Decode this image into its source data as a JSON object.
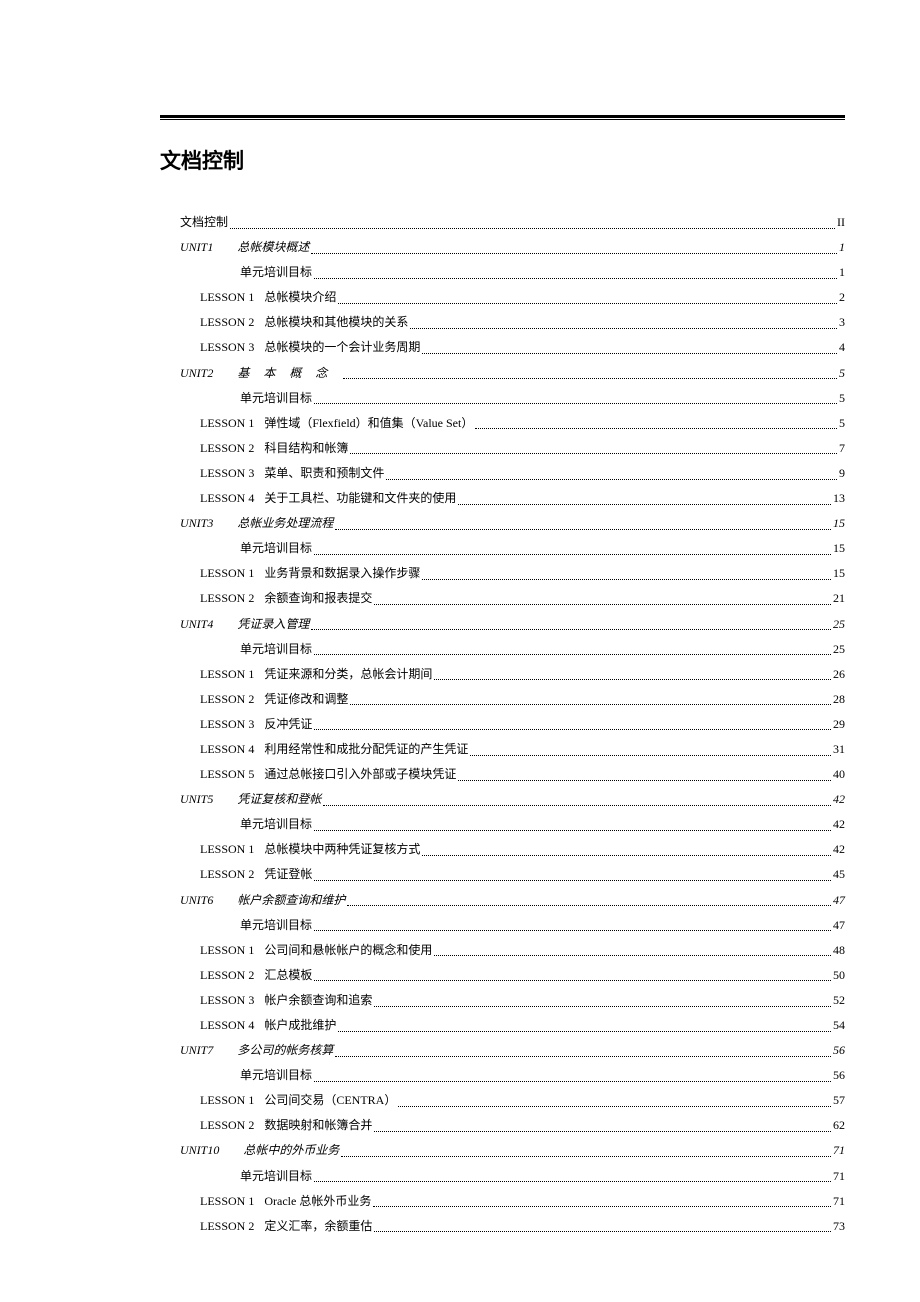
{
  "heading": "文档控制",
  "toc": [
    {
      "type": "plain",
      "indent": 0,
      "label": "文档控制",
      "page": "II"
    },
    {
      "type": "unit",
      "indent": 1,
      "unit": "UNIT1",
      "title": "总帐模块概述",
      "page": "1",
      "spaced": false
    },
    {
      "type": "plain",
      "indent": 2,
      "label": "单元培训目标",
      "page": "1"
    },
    {
      "type": "lesson",
      "indent": 3,
      "lesson": "LESSON 1",
      "title": "总帐模块介绍",
      "page": "2"
    },
    {
      "type": "lesson",
      "indent": 3,
      "lesson": "LESSON 2",
      "title": "总帐模块和其他模块的关系",
      "page": "3"
    },
    {
      "type": "lesson",
      "indent": 3,
      "lesson": "LESSON 3",
      "title": "总帐模块的一个会计业务周期",
      "page": "4"
    },
    {
      "type": "unit",
      "indent": 1,
      "unit": "UNIT2",
      "title": "基本概念",
      "page": "5",
      "spaced": true
    },
    {
      "type": "plain",
      "indent": 2,
      "label": "单元培训目标",
      "page": "5"
    },
    {
      "type": "lesson",
      "indent": 3,
      "lesson": "LESSON 1",
      "title": "弹性域（Flexfield）和值集（Value Set）",
      "page": "5"
    },
    {
      "type": "lesson",
      "indent": 3,
      "lesson": "LESSON 2",
      "title": "科目结构和帐簿",
      "page": "7"
    },
    {
      "type": "lesson",
      "indent": 3,
      "lesson": "LESSON 3",
      "title": "菜单、职责和预制文件",
      "page": "9"
    },
    {
      "type": "lesson",
      "indent": 3,
      "lesson": "LESSON 4",
      "title": "关于工具栏、功能键和文件夹的使用",
      "page": "13"
    },
    {
      "type": "unit",
      "indent": 1,
      "unit": "UNIT3",
      "title": "总帐业务处理流程",
      "page": "15",
      "spaced": false
    },
    {
      "type": "plain",
      "indent": 2,
      "label": "单元培训目标",
      "page": "15"
    },
    {
      "type": "lesson",
      "indent": 3,
      "lesson": "LESSON 1",
      "title": "业务背景和数据录入操作步骤",
      "page": "15"
    },
    {
      "type": "lesson",
      "indent": 3,
      "lesson": "LESSON 2",
      "title": "余额查询和报表提交",
      "page": "21"
    },
    {
      "type": "unit",
      "indent": 1,
      "unit": "UNIT4",
      "title": "凭证录入管理",
      "page": "25",
      "spaced": false
    },
    {
      "type": "plain",
      "indent": 2,
      "label": "单元培训目标",
      "page": "25"
    },
    {
      "type": "lesson",
      "indent": 3,
      "lesson": "LESSON 1",
      "title": "凭证来源和分类，总帐会计期间",
      "page": "26"
    },
    {
      "type": "lesson",
      "indent": 3,
      "lesson": "LESSON 2",
      "title": "凭证修改和调整",
      "page": "28"
    },
    {
      "type": "lesson",
      "indent": 3,
      "lesson": "LESSON 3",
      "title": "反冲凭证",
      "page": "29"
    },
    {
      "type": "lesson",
      "indent": 3,
      "lesson": "LESSON 4",
      "title": "利用经常性和成批分配凭证的产生凭证",
      "page": "31"
    },
    {
      "type": "lesson",
      "indent": 3,
      "lesson": "LESSON 5",
      "title": "通过总帐接口引入外部或子模块凭证",
      "page": "40"
    },
    {
      "type": "unit",
      "indent": 1,
      "unit": "UNIT5",
      "title": "凭证复核和登帐",
      "page": "42",
      "spaced": false
    },
    {
      "type": "plain",
      "indent": 2,
      "label": "单元培训目标",
      "page": "42"
    },
    {
      "type": "lesson",
      "indent": 3,
      "lesson": "LESSON 1",
      "title": "总帐模块中两种凭证复核方式",
      "page": "42"
    },
    {
      "type": "lesson",
      "indent": 3,
      "lesson": "LESSON 2",
      "title": "凭证登帐",
      "page": "45"
    },
    {
      "type": "unit",
      "indent": 1,
      "unit": "UNIT6",
      "title": "帐户余额查询和维护",
      "page": "47",
      "spaced": false
    },
    {
      "type": "plain",
      "indent": 2,
      "label": "单元培训目标",
      "page": "47"
    },
    {
      "type": "lesson",
      "indent": 3,
      "lesson": "LESSON 1",
      "title": "公司间和悬帐帐户的概念和使用",
      "page": "48"
    },
    {
      "type": "lesson",
      "indent": 3,
      "lesson": "LESSON 2",
      "title": "汇总模板",
      "page": "50"
    },
    {
      "type": "lesson",
      "indent": 3,
      "lesson": "LESSON 3",
      "title": "帐户余额查询和追索",
      "page": "52"
    },
    {
      "type": "lesson",
      "indent": 3,
      "lesson": "LESSON 4",
      "title": "帐户成批维护",
      "page": "54"
    },
    {
      "type": "unit",
      "indent": 1,
      "unit": "UNIT7",
      "title": "多公司的帐务核算",
      "page": "56",
      "spaced": false
    },
    {
      "type": "plain",
      "indent": 2,
      "label": "单元培训目标",
      "page": "56"
    },
    {
      "type": "lesson",
      "indent": 3,
      "lesson": "LESSON 1",
      "title": "公司间交易（CENTRA）",
      "page": "57"
    },
    {
      "type": "lesson",
      "indent": 3,
      "lesson": "LESSON 2",
      "title": "数据映射和帐簿合并",
      "page": "62"
    },
    {
      "type": "unit",
      "indent": 1,
      "unit": "UNIT10",
      "title": "总帐中的外币业务",
      "page": "71",
      "spaced": false
    },
    {
      "type": "plain",
      "indent": 2,
      "label": "单元培训目标",
      "page": "71"
    },
    {
      "type": "lesson",
      "indent": 3,
      "lesson": "LESSON 1",
      "title": "Oracle  总帐外币业务",
      "page": "71"
    },
    {
      "type": "lesson",
      "indent": 3,
      "lesson": "LESSON 2",
      "title": "定义汇率，余额重估",
      "page": "73"
    }
  ]
}
